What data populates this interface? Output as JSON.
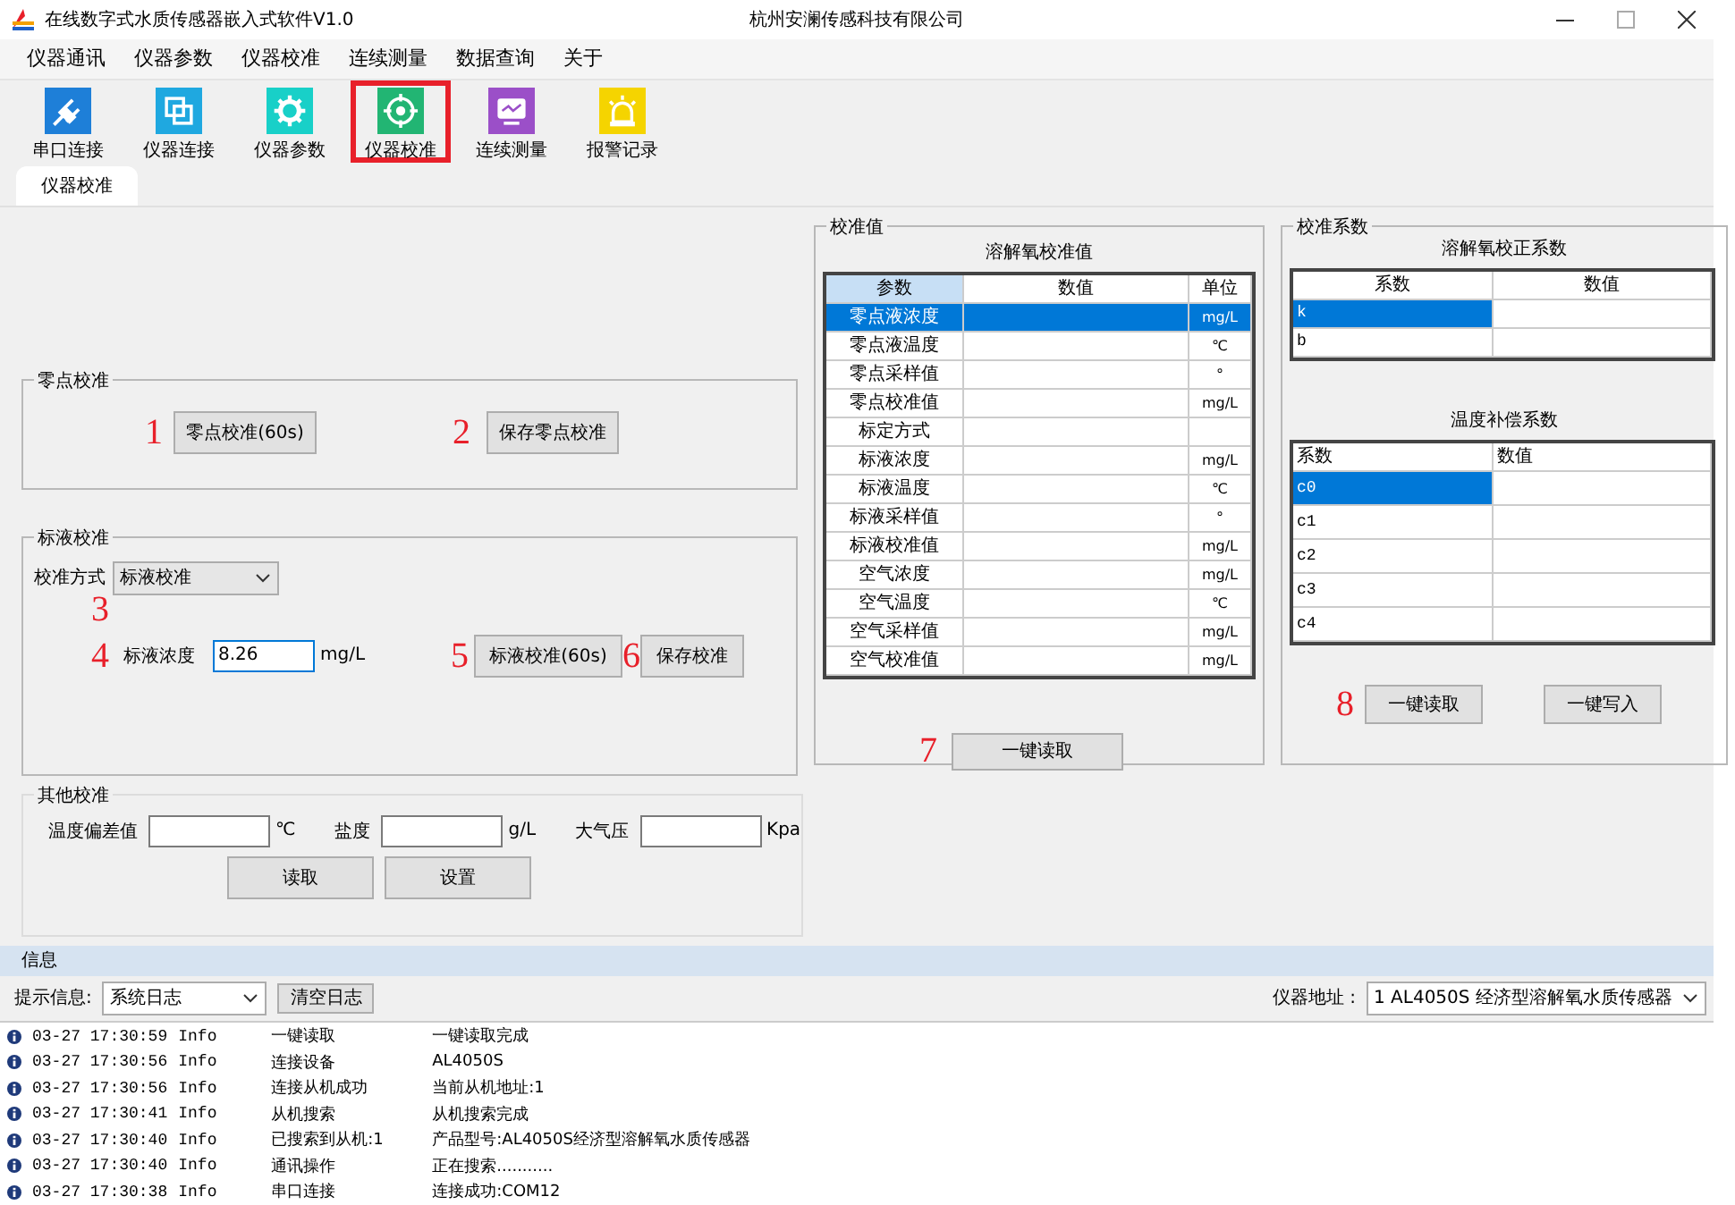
{
  "window": {
    "title": "在线数字式水质传感器嵌入式软件V1.0",
    "company": "杭州安澜传感科技有限公司"
  },
  "menu": [
    "仪器通讯",
    "仪器参数",
    "仪器校准",
    "连续测量",
    "数据查询",
    "关于"
  ],
  "toolbar": [
    {
      "label": "串口连接",
      "selected": false
    },
    {
      "label": "仪器连接",
      "selected": false
    },
    {
      "label": "仪器参数",
      "selected": false
    },
    {
      "label": "仪器校准",
      "selected": true
    },
    {
      "label": "连续测量",
      "selected": false
    },
    {
      "label": "报警记录",
      "selected": false
    }
  ],
  "tabs": [
    {
      "label": "仪器校准",
      "selected": true
    }
  ],
  "zero_calibration": {
    "title": "零点校准",
    "buttons": [
      {
        "marker": "1",
        "label": "零点校准(60s)"
      },
      {
        "marker": "2",
        "label": "保存零点校准"
      }
    ]
  },
  "standard_calibration": {
    "title": "标液校准",
    "method_label": "校准方式",
    "method_value": "标液校准",
    "method_marker": "3",
    "concentration": {
      "marker": "4",
      "label": "标液浓度",
      "value": "8.26",
      "unit": "mg/L"
    },
    "buttons": [
      {
        "marker": "5",
        "label": "标液校准(60s)"
      },
      {
        "marker": "6",
        "label": "保存校准"
      }
    ]
  },
  "other_calibration": {
    "title": "其他校准",
    "fields": [
      {
        "label": "温度偏差值",
        "unit": "℃"
      },
      {
        "label": "盐度",
        "unit": "g/L"
      },
      {
        "label": "大气压",
        "unit": "Kpa"
      }
    ],
    "buttons": [
      "读取",
      "设置"
    ]
  },
  "calibration_values": {
    "title": "校准值",
    "table_title": "溶解氧校准值",
    "columns": [
      {
        "label": "参数",
        "selected": true
      },
      {
        "label": "数值",
        "selected": false
      },
      {
        "label": "单位",
        "selected": false
      }
    ],
    "rows": [
      {
        "param": "零点液浓度",
        "unit": "mg/L",
        "selected": true
      },
      {
        "param": "零点液温度",
        "unit": "℃",
        "selected": false
      },
      {
        "param": "零点采样值",
        "unit": "°",
        "selected": false
      },
      {
        "param": "零点校准值",
        "unit": "mg/L",
        "selected": false
      },
      {
        "param": "标定方式",
        "selected": false
      },
      {
        "param": "标液浓度",
        "unit": "mg/L",
        "selected": false
      },
      {
        "param": "标液温度",
        "unit": "℃",
        "selected": false
      },
      {
        "param": "标液采样值",
        "unit": "°",
        "selected": false
      },
      {
        "param": "标液校准值",
        "unit": "mg/L",
        "selected": false
      },
      {
        "param": "空气浓度",
        "unit": "mg/L",
        "selected": false
      },
      {
        "param": "空气温度",
        "unit": "℃",
        "selected": false
      },
      {
        "param": "空气采样值",
        "unit": "mg/L",
        "selected": false
      },
      {
        "param": "空气校准值",
        "unit": "mg/L",
        "selected": false
      }
    ],
    "marker": "7",
    "button": "一键读取"
  },
  "coefficients": {
    "title": "校准系数",
    "tables": [
      {
        "title": "溶解氧校正系数",
        "columns": [
          "系数",
          "数值"
        ],
        "rows": [
          {
            "name": "k",
            "selected": true
          },
          {
            "name": "b",
            "selected": false
          }
        ]
      },
      {
        "title": "温度补偿系数",
        "columns": [
          "系数",
          "数值"
        ],
        "rows": [
          {
            "name": "c0",
            "selected": true
          },
          {
            "name": "c1",
            "selected": false
          },
          {
            "name": "c2",
            "selected": false
          },
          {
            "name": "c3",
            "selected": false
          },
          {
            "name": "c4",
            "selected": false
          }
        ]
      }
    ],
    "buttons": [
      {
        "marker": "8",
        "label": "一键读取"
      },
      {
        "label": "一键写入"
      }
    ]
  },
  "info": {
    "title": "信息",
    "hint_label": "提示信息:",
    "log_filter": "系统日志",
    "clear_button": "清空日志",
    "address_label": "仪器地址 :",
    "address_value": "1  AL4050S 经济型溶解氧水质传感器",
    "log": [
      {
        "time": "03-27 17:30:59",
        "level": "Info",
        "action": "一键读取",
        "message": "一键读取完成"
      },
      {
        "time": "03-27 17:30:56",
        "level": "Info",
        "action": "连接设备",
        "message": "AL4050S"
      },
      {
        "time": "03-27 17:30:56",
        "level": "Info",
        "action": "连接从机成功",
        "message": "当前从机地址:1"
      },
      {
        "time": "03-27 17:30:41",
        "level": "Info",
        "action": "从机搜索",
        "message": "从机搜索完成"
      },
      {
        "time": "03-27 17:30:40",
        "level": "Info",
        "action": "已搜索到从机:1",
        "message": "产品型号:AL4050S经济型溶解氧水质传感器"
      },
      {
        "time": "03-27 17:30:40",
        "level": "Info",
        "action": "通讯操作",
        "message": "正在搜索..........."
      },
      {
        "time": "03-27 17:30:38",
        "level": "Info",
        "action": "串口连接",
        "message": "连接成功:COM12"
      }
    ]
  }
}
